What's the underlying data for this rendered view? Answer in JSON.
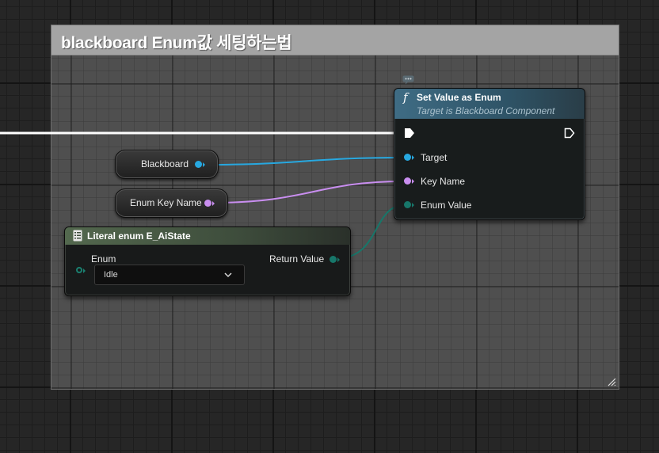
{
  "comment": {
    "title": "blackboard Enum값 세팅하는법"
  },
  "function_node": {
    "title": "Set Value as Enum",
    "subtitle": "Target is Blackboard Component",
    "icon": "function-icon",
    "pins": {
      "target": "Target",
      "key_name": "Key Name",
      "enum_value": "Enum Value"
    }
  },
  "variables": {
    "blackboard": "Blackboard",
    "enum_key_name": "Enum Key Name"
  },
  "literal_node": {
    "title": "Literal enum E_AiState",
    "icon": "enum-literal-icon",
    "enum_label": "Enum",
    "return_label": "Return Value",
    "selected_value": "Idle"
  },
  "colors": {
    "object_pin": "#27a8e0",
    "name_pin": "#c98ef0",
    "enum_pin": "#17776a",
    "exec_wire": "#ffffff",
    "comment_header": "#a4a4a4"
  }
}
